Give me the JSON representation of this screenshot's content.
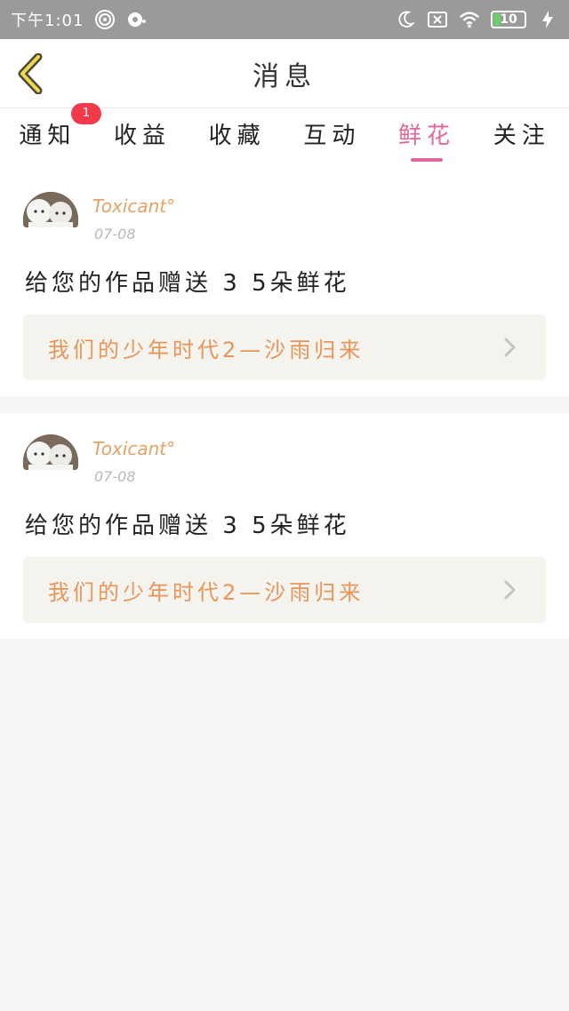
{
  "status_bar": {
    "time": "下午1:01",
    "icons": [
      "hotspot-icon",
      "music-icon",
      "moon-icon",
      "sim-off-icon",
      "wifi-icon",
      "charging-icon"
    ],
    "battery_level": "10"
  },
  "header": {
    "title": "消息"
  },
  "tabs": [
    {
      "label": "通知",
      "badge": "1"
    },
    {
      "label": "收益"
    },
    {
      "label": "收藏"
    },
    {
      "label": "互动"
    },
    {
      "label": "鲜花",
      "active": true
    },
    {
      "label": "关注"
    }
  ],
  "messages": [
    {
      "username": "Toxicant°",
      "date": "07-08",
      "text": "给您的作品赠送 3 5朵鲜花",
      "work_title": "我们的少年时代2—沙雨归来"
    },
    {
      "username": "Toxicant°",
      "date": "07-08",
      "text": "给您的作品赠送 3 5朵鲜花",
      "work_title": "我们的少年时代2—沙雨归来"
    }
  ],
  "colors": {
    "accent": "#e0679a",
    "username": "#e8a064",
    "work_title": "#e8955a",
    "badge": "#f23a4a",
    "status_bar": "#9a9a9a"
  }
}
